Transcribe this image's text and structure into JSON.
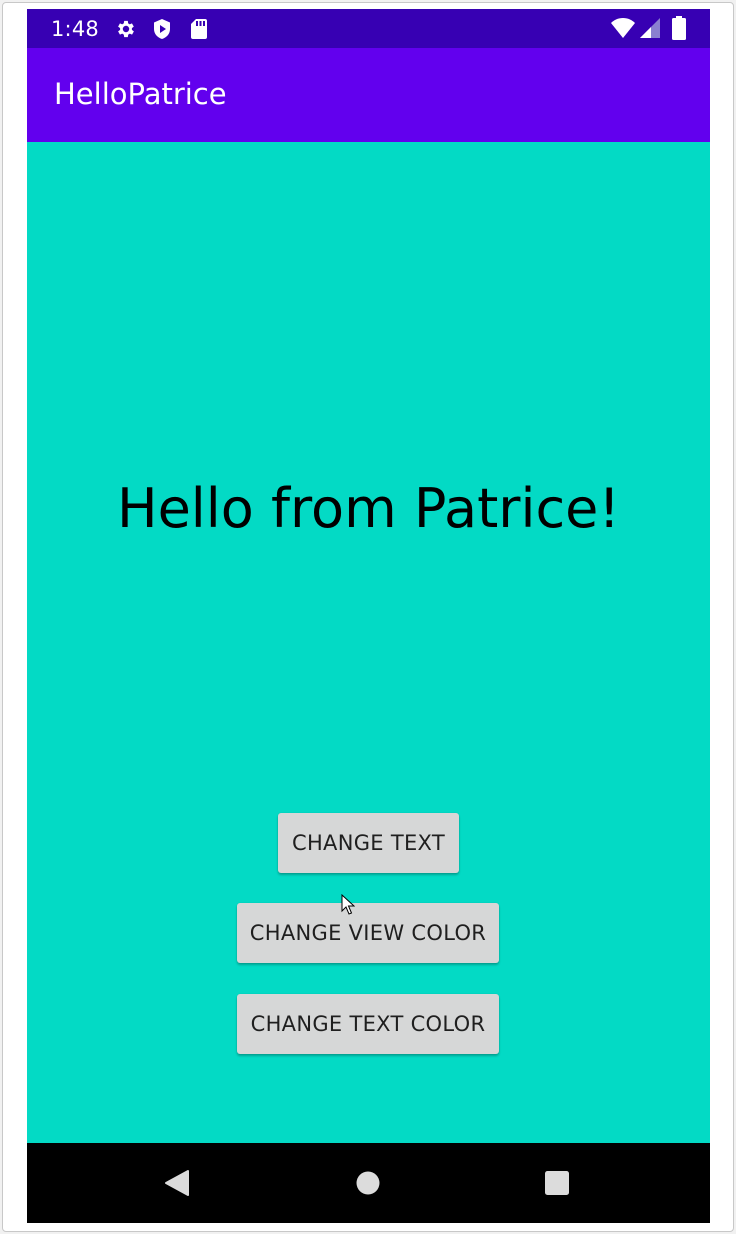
{
  "status_bar": {
    "time": "1:48",
    "icons_left": [
      "gear-icon",
      "shield-play-icon",
      "sd-card-icon"
    ],
    "icons_right": [
      "wifi-icon",
      "signal-icon",
      "battery-icon"
    ],
    "background": "#3700b3"
  },
  "app_bar": {
    "title": "HelloPatrice",
    "background": "#6200ee"
  },
  "content": {
    "background": "#03dac5",
    "hello_text": "Hello from Patrice!",
    "buttons": {
      "change_text": "CHANGE TEXT",
      "change_view_color": "CHANGE VIEW COLOR",
      "change_text_color": "CHANGE TEXT COLOR"
    }
  },
  "nav_bar": {
    "icons": [
      "back-icon",
      "home-icon",
      "recents-icon"
    ]
  }
}
